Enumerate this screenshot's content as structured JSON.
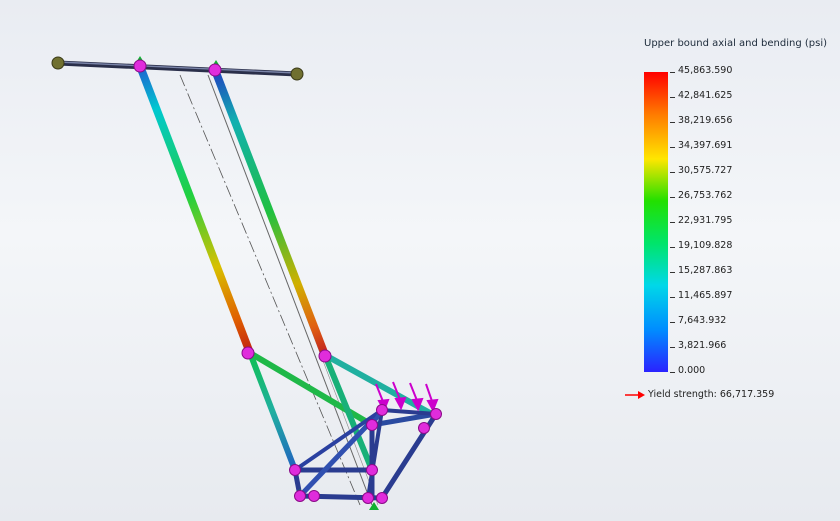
{
  "legend": {
    "title": "Upper bound axial and bending (psi)",
    "ticks": [
      "45,863.590",
      "42,841.625",
      "38,219.656",
      "34,397.691",
      "30,575.727",
      "26,753.762",
      "22,931.795",
      "19,109.828",
      "15,287.863",
      "11,465.897",
      "7,643.932",
      "3,821.966",
      "0.000"
    ],
    "yield_label": "Yield strength: 66,717.359",
    "colors": [
      "#ff0000",
      "#ff7a00",
      "#ffe600",
      "#22e000",
      "#00e56a",
      "#00d8e8",
      "#008cff",
      "#2a22ff"
    ],
    "yield_arrow_color": "#ff0000"
  }
}
